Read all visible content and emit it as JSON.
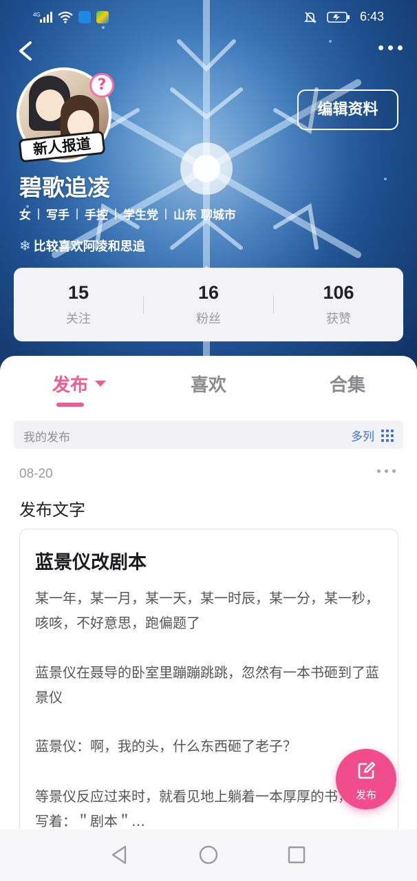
{
  "status_bar": {
    "signal": "4G",
    "time": "6:43",
    "icons": [
      "signal-icon",
      "wifi-icon",
      "shield-app-icon",
      "play-app-icon",
      "mute-icon",
      "battery-icon"
    ]
  },
  "profile": {
    "newbie_tag": "新人报道",
    "help_badge": "?",
    "edit_button": "编辑资料",
    "username": "碧歌追凌",
    "tags": [
      "女",
      "写手",
      "手控",
      "学生党",
      "山东 聊城市"
    ],
    "bio": "比较喜欢阿凌和思追",
    "stats": [
      {
        "value": "15",
        "label": "关注"
      },
      {
        "value": "16",
        "label": "粉丝"
      },
      {
        "value": "106",
        "label": "获赞"
      }
    ]
  },
  "tabs": {
    "items": [
      "发布",
      "喜欢",
      "合集"
    ],
    "active": "发布"
  },
  "filter": {
    "title": "我的发布",
    "view_mode": "多列"
  },
  "post": {
    "date": "08-20",
    "type": "发布文字",
    "article_title": "蓝景仪改剧本",
    "paragraphs": [
      "某一年，某一月，某一天，某一时辰，某一分，某一秒，咳咳，不好意思，跑偏题了",
      "蓝景仪在聂导的卧室里蹦蹦跳跳，忽然有一本书砸到了蓝景仪",
      "蓝景仪：啊，我的头，什么东西砸了老子？",
      "等景仪反应过来时，就看见地上躺着一本厚厚的书，书名写着：＂剧本＂…"
    ]
  },
  "fab": {
    "label": "发布"
  },
  "colors": {
    "accent": "#f25a93",
    "link": "#3f73c9",
    "hero_dark": "#0f2e5c"
  }
}
